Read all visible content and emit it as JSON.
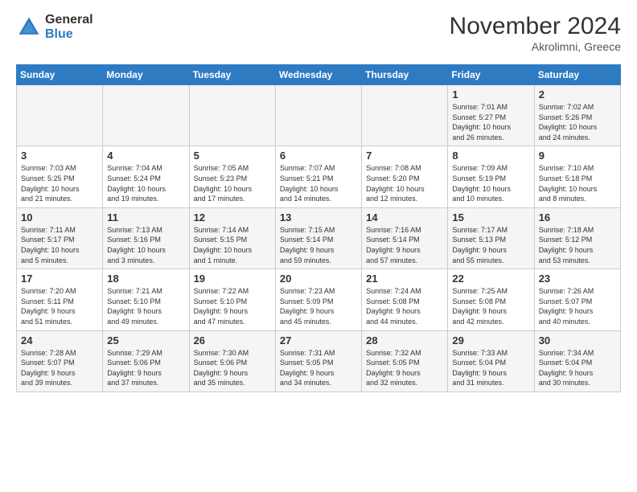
{
  "header": {
    "logo_general": "General",
    "logo_blue": "Blue",
    "title": "November 2024",
    "location": "Akrolimni, Greece"
  },
  "days_of_week": [
    "Sunday",
    "Monday",
    "Tuesday",
    "Wednesday",
    "Thursday",
    "Friday",
    "Saturday"
  ],
  "weeks": [
    [
      {
        "day": "",
        "info": ""
      },
      {
        "day": "",
        "info": ""
      },
      {
        "day": "",
        "info": ""
      },
      {
        "day": "",
        "info": ""
      },
      {
        "day": "",
        "info": ""
      },
      {
        "day": "1",
        "info": "Sunrise: 7:01 AM\nSunset: 5:27 PM\nDaylight: 10 hours\nand 26 minutes."
      },
      {
        "day": "2",
        "info": "Sunrise: 7:02 AM\nSunset: 5:26 PM\nDaylight: 10 hours\nand 24 minutes."
      }
    ],
    [
      {
        "day": "3",
        "info": "Sunrise: 7:03 AM\nSunset: 5:25 PM\nDaylight: 10 hours\nand 21 minutes."
      },
      {
        "day": "4",
        "info": "Sunrise: 7:04 AM\nSunset: 5:24 PM\nDaylight: 10 hours\nand 19 minutes."
      },
      {
        "day": "5",
        "info": "Sunrise: 7:05 AM\nSunset: 5:23 PM\nDaylight: 10 hours\nand 17 minutes."
      },
      {
        "day": "6",
        "info": "Sunrise: 7:07 AM\nSunset: 5:21 PM\nDaylight: 10 hours\nand 14 minutes."
      },
      {
        "day": "7",
        "info": "Sunrise: 7:08 AM\nSunset: 5:20 PM\nDaylight: 10 hours\nand 12 minutes."
      },
      {
        "day": "8",
        "info": "Sunrise: 7:09 AM\nSunset: 5:19 PM\nDaylight: 10 hours\nand 10 minutes."
      },
      {
        "day": "9",
        "info": "Sunrise: 7:10 AM\nSunset: 5:18 PM\nDaylight: 10 hours\nand 8 minutes."
      }
    ],
    [
      {
        "day": "10",
        "info": "Sunrise: 7:11 AM\nSunset: 5:17 PM\nDaylight: 10 hours\nand 5 minutes."
      },
      {
        "day": "11",
        "info": "Sunrise: 7:13 AM\nSunset: 5:16 PM\nDaylight: 10 hours\nand 3 minutes."
      },
      {
        "day": "12",
        "info": "Sunrise: 7:14 AM\nSunset: 5:15 PM\nDaylight: 10 hours\nand 1 minute."
      },
      {
        "day": "13",
        "info": "Sunrise: 7:15 AM\nSunset: 5:14 PM\nDaylight: 9 hours\nand 59 minutes."
      },
      {
        "day": "14",
        "info": "Sunrise: 7:16 AM\nSunset: 5:14 PM\nDaylight: 9 hours\nand 57 minutes."
      },
      {
        "day": "15",
        "info": "Sunrise: 7:17 AM\nSunset: 5:13 PM\nDaylight: 9 hours\nand 55 minutes."
      },
      {
        "day": "16",
        "info": "Sunrise: 7:18 AM\nSunset: 5:12 PM\nDaylight: 9 hours\nand 53 minutes."
      }
    ],
    [
      {
        "day": "17",
        "info": "Sunrise: 7:20 AM\nSunset: 5:11 PM\nDaylight: 9 hours\nand 51 minutes."
      },
      {
        "day": "18",
        "info": "Sunrise: 7:21 AM\nSunset: 5:10 PM\nDaylight: 9 hours\nand 49 minutes."
      },
      {
        "day": "19",
        "info": "Sunrise: 7:22 AM\nSunset: 5:10 PM\nDaylight: 9 hours\nand 47 minutes."
      },
      {
        "day": "20",
        "info": "Sunrise: 7:23 AM\nSunset: 5:09 PM\nDaylight: 9 hours\nand 45 minutes."
      },
      {
        "day": "21",
        "info": "Sunrise: 7:24 AM\nSunset: 5:08 PM\nDaylight: 9 hours\nand 44 minutes."
      },
      {
        "day": "22",
        "info": "Sunrise: 7:25 AM\nSunset: 5:08 PM\nDaylight: 9 hours\nand 42 minutes."
      },
      {
        "day": "23",
        "info": "Sunrise: 7:26 AM\nSunset: 5:07 PM\nDaylight: 9 hours\nand 40 minutes."
      }
    ],
    [
      {
        "day": "24",
        "info": "Sunrise: 7:28 AM\nSunset: 5:07 PM\nDaylight: 9 hours\nand 39 minutes."
      },
      {
        "day": "25",
        "info": "Sunrise: 7:29 AM\nSunset: 5:06 PM\nDaylight: 9 hours\nand 37 minutes."
      },
      {
        "day": "26",
        "info": "Sunrise: 7:30 AM\nSunset: 5:06 PM\nDaylight: 9 hours\nand 35 minutes."
      },
      {
        "day": "27",
        "info": "Sunrise: 7:31 AM\nSunset: 5:05 PM\nDaylight: 9 hours\nand 34 minutes."
      },
      {
        "day": "28",
        "info": "Sunrise: 7:32 AM\nSunset: 5:05 PM\nDaylight: 9 hours\nand 32 minutes."
      },
      {
        "day": "29",
        "info": "Sunrise: 7:33 AM\nSunset: 5:04 PM\nDaylight: 9 hours\nand 31 minutes."
      },
      {
        "day": "30",
        "info": "Sunrise: 7:34 AM\nSunset: 5:04 PM\nDaylight: 9 hours\nand 30 minutes."
      }
    ]
  ]
}
